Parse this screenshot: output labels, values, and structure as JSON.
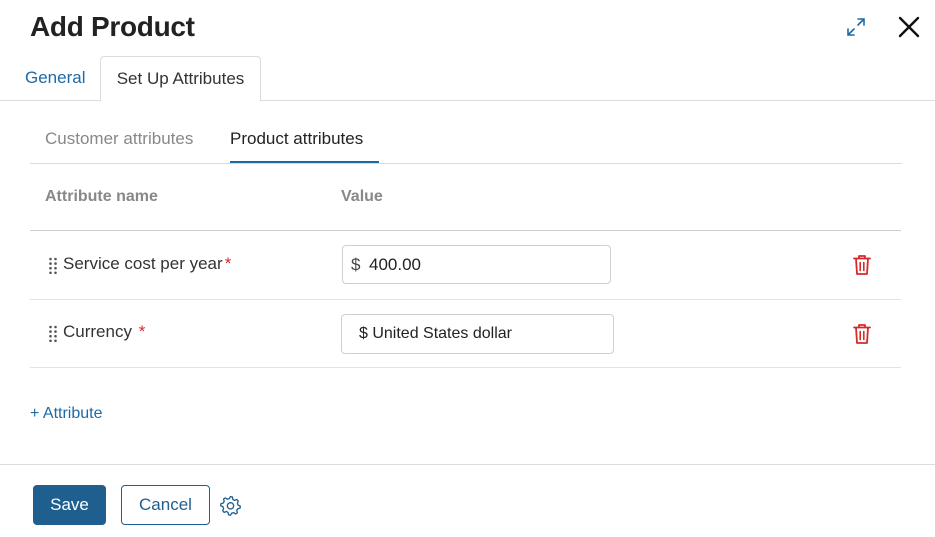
{
  "dialog": {
    "title": "Add Product"
  },
  "tabs": [
    {
      "label": "General",
      "active": false
    },
    {
      "label": "Set Up Attributes",
      "active": true
    }
  ],
  "subtabs": [
    {
      "label": "Customer attributes",
      "active": false
    },
    {
      "label": "Product attributes",
      "active": true
    }
  ],
  "table": {
    "columns": [
      "Attribute name",
      "Value"
    ],
    "rows": [
      {
        "name": "Service cost per year",
        "required_mark": "*",
        "currency_sign": "$",
        "value": "400.00"
      },
      {
        "name": "Currency",
        "required_mark": "*",
        "value": "$ United States dollar"
      }
    ]
  },
  "add_attribute_label": "+ Attribute",
  "footer": {
    "save_label": "Save",
    "cancel_label": "Cancel"
  },
  "icons": {
    "expand": "expand-icon",
    "close": "close-icon",
    "drag": "drag-handle-icon",
    "delete": "trash-icon",
    "settings": "gear-icon"
  },
  "colors": {
    "accent": "#1e6aa5",
    "primary_button": "#1f5f8f",
    "required": "#d42a2a",
    "delete": "#d42a2a"
  }
}
